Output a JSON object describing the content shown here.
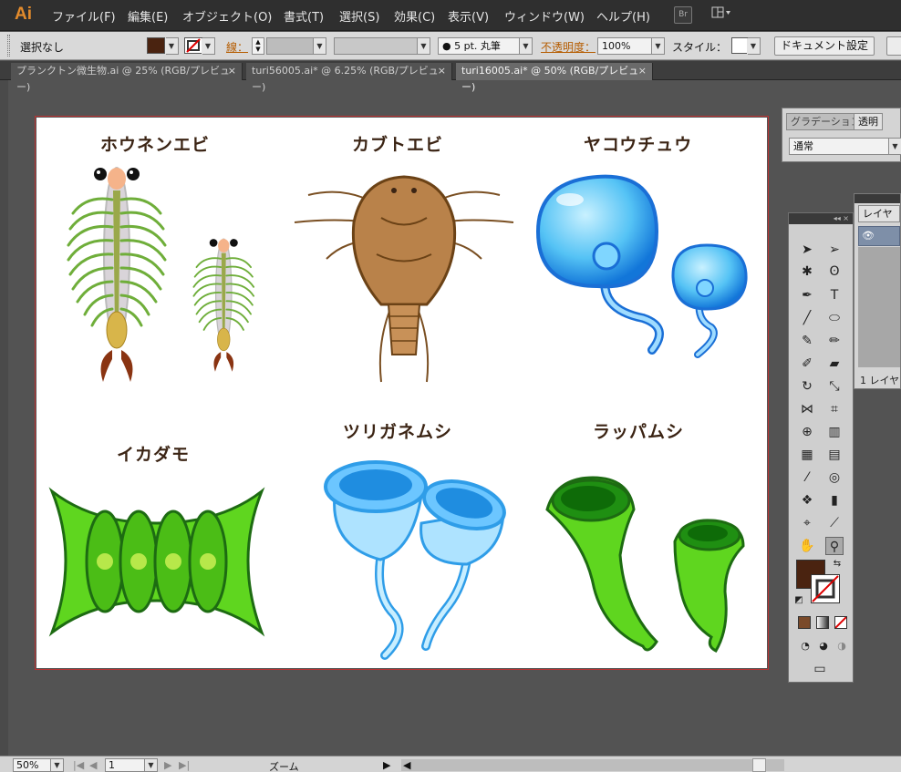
{
  "app": {
    "logo": "Ai"
  },
  "menu": [
    "ファイル(F)",
    "編集(E)",
    "オブジェクト(O)",
    "書式(T)",
    "選択(S)",
    "効果(C)",
    "表示(V)",
    "ウィンドウ(W)",
    "ヘルプ(H)"
  ],
  "menubar": {
    "bridge_label": "Br",
    "workspace_arrow": "▾"
  },
  "control": {
    "selection": "選択なし",
    "stroke_label": "線：",
    "brush": "● 5 pt. 丸筆",
    "opacity_label": "不透明度：",
    "opacity_value": "100%",
    "style_label": "スタイル：",
    "doc_settings": "ドキュメント設定",
    "fill_color": "#4a2310"
  },
  "tabs": [
    {
      "label": "プランクトン微生物.ai @ 25% (RGB/プレビュー)"
    },
    {
      "label": "turi56005.ai* @ 6.25% (RGB/プレビュー)"
    },
    {
      "label": "turi16005.ai* @ 50% (RGB/プレビュー)"
    }
  ],
  "tab_close": "×",
  "artwork": {
    "titles": [
      "ホウネンエビ",
      "カブトエビ",
      "ヤコウチュウ",
      "イカダモ",
      "ツリガネムシ",
      "ラッパムシ"
    ]
  },
  "panels": {
    "gradient_tab": "グラデーション",
    "transparency_tab": "透明",
    "blend_mode": "通常",
    "layers_tab": "レイヤー",
    "layers_count": "1 レイヤ"
  },
  "toolbox": {
    "collapse": "◂◂ ×"
  },
  "status": {
    "zoom": "50%",
    "page": "1",
    "mode": "ズーム"
  }
}
